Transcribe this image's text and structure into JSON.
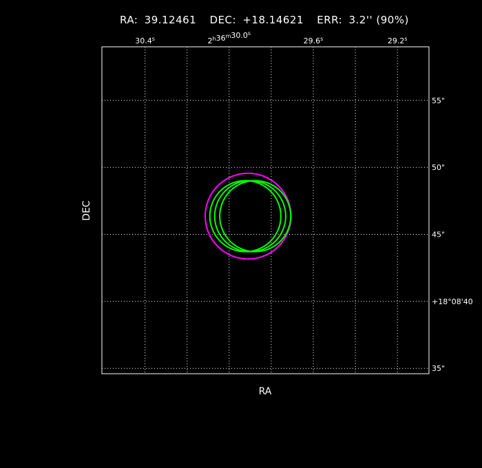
{
  "title": {
    "ra_label": "RA:",
    "ra_value": "39.12461",
    "dec_label": "DEC:",
    "dec_value": "+18.14621",
    "err_label": "ERR:",
    "err_value": "3.2'' (90%)"
  },
  "chart_data": {
    "type": "scatter",
    "title": "RA: 39.12461  DEC: +18.14621  ERR: 3.2'' (90%)",
    "xlabel": "RA",
    "ylabel": "DEC",
    "x_unit": "arcsec offset (RA sexagesimal seconds)",
    "xlim_seconds": [
      30.605,
      29.05
    ],
    "ylim_arcsec": [
      34.6,
      59.0
    ],
    "grid": true,
    "x_grid_seconds": [
      30.4,
      30.2,
      30.0,
      29.8,
      29.6,
      29.4,
      29.2
    ],
    "y_grid_arcsec": [
      35,
      40,
      45,
      50,
      55
    ],
    "x_ticks": [
      {
        "value": 30.4,
        "label": "30.4s"
      },
      {
        "value": 30.0,
        "label": "2h36m30.0s"
      },
      {
        "value": 29.6,
        "label": "29.6s"
      },
      {
        "value": 29.2,
        "label": "29.2s"
      }
    ],
    "y_ticks": [
      {
        "value": 55,
        "label": "55\""
      },
      {
        "value": 50,
        "label": "50\""
      },
      {
        "value": 45,
        "label": "45\""
      },
      {
        "value": 40,
        "label": "+18°08'40"
      },
      {
        "value": 35,
        "label": "35\""
      }
    ],
    "circles": [
      {
        "name": "error-circle",
        "ra_seconds": 29.91,
        "dec_arcsec": 46.36,
        "radius_arcsec": 3.2,
        "color": "#ff00ff"
      },
      {
        "name": "source-1",
        "ra_seconds": 29.923,
        "dec_arcsec": 46.36,
        "radius_arcsec": 2.65,
        "color": "#00ff00"
      },
      {
        "name": "source-2",
        "ra_seconds": 29.9,
        "dec_arcsec": 46.36,
        "radius_arcsec": 2.65,
        "color": "#00ff00"
      },
      {
        "name": "source-3",
        "ra_seconds": 29.876,
        "dec_arcsec": 46.36,
        "radius_arcsec": 2.65,
        "color": "#00ff00"
      }
    ]
  },
  "colors": {
    "background": "#000000",
    "axes": "#ffffff",
    "grid": "#ffffff",
    "error_circle": "#ff00ff",
    "source_circle": "#00ff00"
  }
}
